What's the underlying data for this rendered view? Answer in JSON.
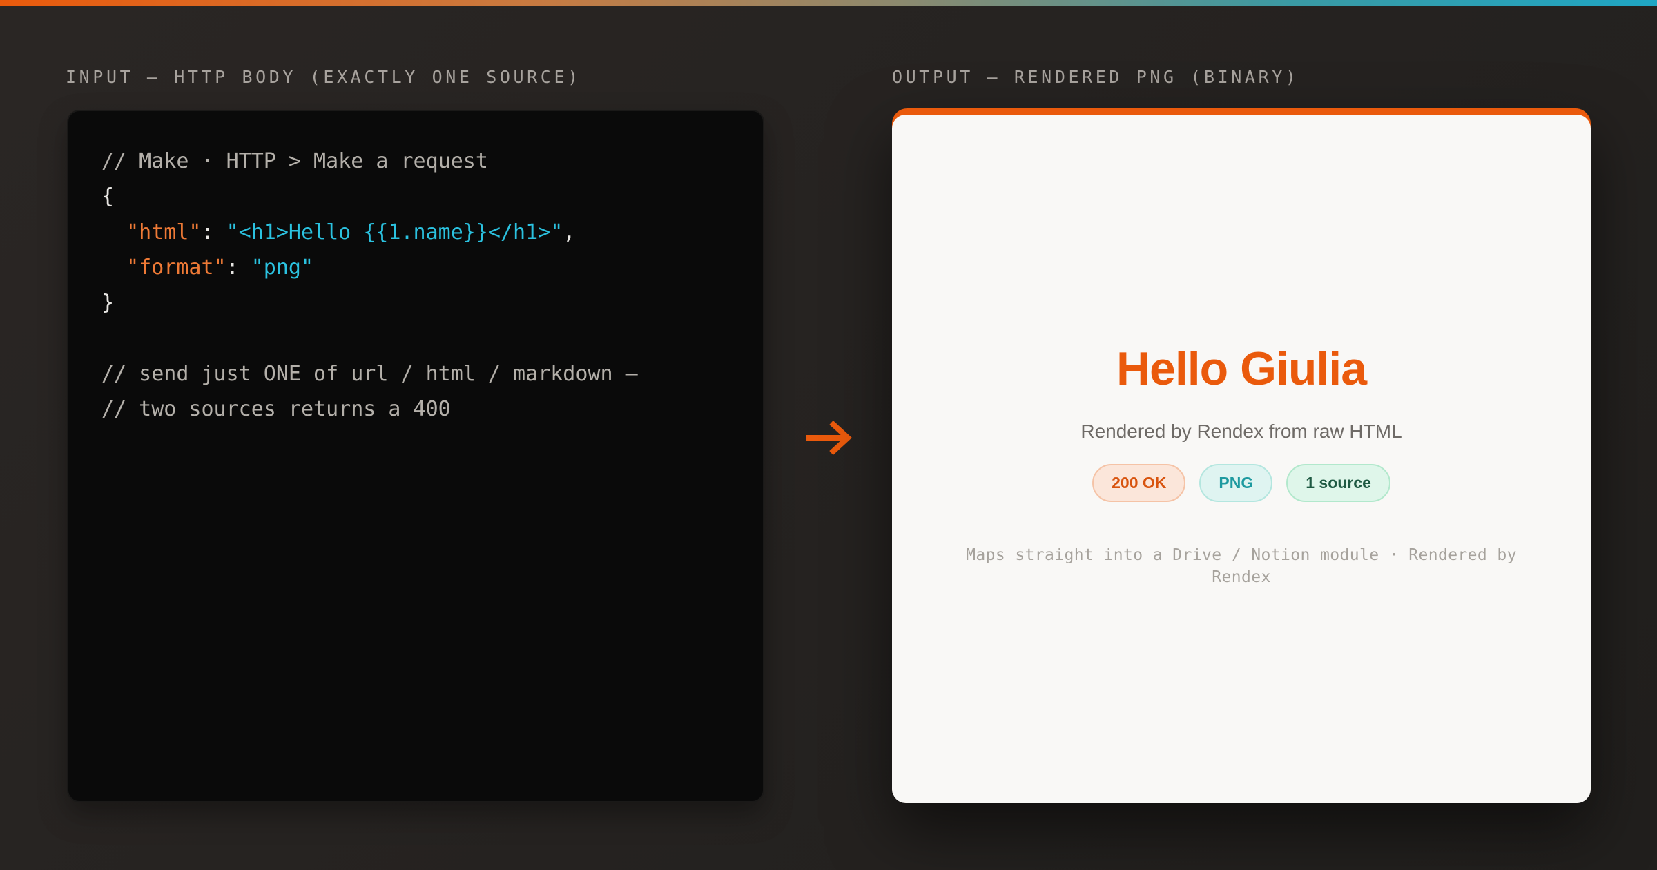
{
  "input_label": "INPUT — HTTP BODY (EXACTLY ONE SOURCE)",
  "output_label": "OUTPUT — RENDERED PNG (BINARY)",
  "code": {
    "comment_header": "// Make · HTTP > Make a request",
    "open_brace": "{",
    "key_html": "\"html\"",
    "colon": ": ",
    "value_html": "\"<h1>Hello {{1.name}}</h1>\"",
    "comma": ",",
    "key_format": "\"format\"",
    "value_format": "\"png\"",
    "close_brace": "}",
    "note_line_1": "// send just ONE of url / html / markdown —",
    "note_line_2": "// two sources returns a 400"
  },
  "arrow_icon": "arrow-right-icon",
  "accent_color": "#ea5a0c",
  "render": {
    "title": "Hello Giulia",
    "subtitle": "Rendered by Rendex from raw HTML",
    "badges": [
      "200 OK",
      "PNG",
      "1 source"
    ],
    "footer": "Maps straight into a Drive / Notion module · Rendered by Rendex"
  }
}
